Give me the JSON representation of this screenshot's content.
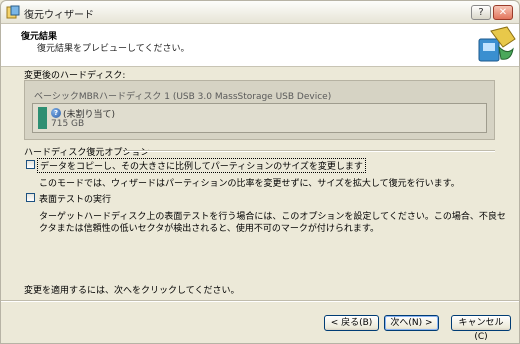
{
  "window": {
    "title": "復元ウィザード",
    "help_label": "?",
    "close_label": "✕"
  },
  "header": {
    "title": "復元結果",
    "subtitle": "復元結果をプレビューしてください。"
  },
  "disk_section": {
    "label": "変更後のハードディスク:",
    "disk_title": "ベーシックMBRハードディスク 1 (USB 3.0 MassStorage USB Device)",
    "partition": {
      "icon": "?",
      "name": "(未割り当て)",
      "size": "715 GB"
    }
  },
  "options": {
    "title": "ハードディスク復元オプション",
    "option1": {
      "label": "データをコピーし、その大きさに比例してパーティションのサイズを変更します",
      "checked": false,
      "description": "このモードでは、ウィザードはパーティションの比率を変更せずに、サイズを拡大して復元を行います。"
    },
    "option2": {
      "label": "表面テストの実行",
      "checked": false,
      "description": "ターゲットハードディスク上の表面テストを行う場合には、このオプションを設定してください。この場合、不良セクタまたは信頼性の低いセクタが検出されると、使用不可のマークが付けられます。"
    }
  },
  "footer_text": "変更を適用するには、次へをクリックしてください。",
  "buttons": {
    "back": "< 戻る(B)",
    "next": "次へ(N) >",
    "cancel": "キャンセル(C)"
  }
}
